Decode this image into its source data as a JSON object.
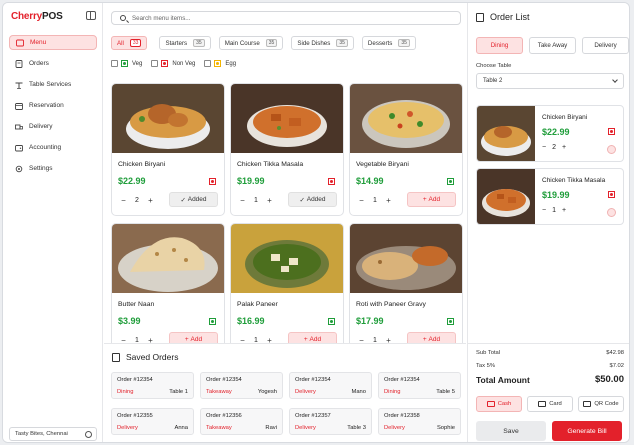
{
  "brand": {
    "part1": "Cherry",
    "part2": "POS"
  },
  "sidebar": {
    "items": [
      {
        "label": "Menu",
        "icon": "menu-icon",
        "active": true
      },
      {
        "label": "Orders",
        "icon": "orders-icon"
      },
      {
        "label": "Table Services",
        "icon": "table-icon"
      },
      {
        "label": "Reservation",
        "icon": "reservation-icon"
      },
      {
        "label": "Delivery",
        "icon": "truck-icon"
      },
      {
        "label": "Accounting",
        "icon": "wallet-icon"
      },
      {
        "label": "Settings",
        "icon": "gear-icon"
      }
    ],
    "store": "Tasty Bites, Chennai"
  },
  "search": {
    "placeholder": "Search menu items..."
  },
  "categories": [
    {
      "label": "All",
      "count": "33",
      "active": true
    },
    {
      "label": "Starters",
      "count": "35"
    },
    {
      "label": "Main Course",
      "count": "35"
    },
    {
      "label": "Side Dishes",
      "count": "35"
    },
    {
      "label": "Desserts",
      "count": "35"
    }
  ],
  "filters": [
    {
      "label": "Veg",
      "color": "#1f9d3a"
    },
    {
      "label": "Non Veg",
      "color": "#e3212b"
    },
    {
      "label": "Egg",
      "color": "#f2b400"
    }
  ],
  "menu_items": [
    {
      "name": "Chicken Biryani",
      "price": "$22.99",
      "qty": "2",
      "veg": false,
      "button": "Added",
      "added": true
    },
    {
      "name": "Chicken Tikka Masala",
      "price": "$19.99",
      "qty": "1",
      "veg": false,
      "button": "Added",
      "added": true
    },
    {
      "name": "Vegetable Biryani",
      "price": "$14.99",
      "qty": "1",
      "veg": true,
      "button": "Add",
      "added": false
    },
    {
      "name": "Butter Naan",
      "price": "$3.99",
      "qty": "1",
      "veg": true,
      "button": "Add",
      "added": false
    },
    {
      "name": "Palak Paneer",
      "price": "$16.99",
      "qty": "1",
      "veg": true,
      "button": "Add",
      "added": false
    },
    {
      "name": "Roti with Paneer Gravy",
      "price": "$17.99",
      "qty": "1",
      "veg": true,
      "button": "Add",
      "added": false
    }
  ],
  "saved": {
    "title": "Saved Orders",
    "orders": [
      {
        "id": "Order #12354",
        "type": "Dining",
        "who": "Table 1"
      },
      {
        "id": "Order #12354",
        "type": "Takeaway",
        "who": "Yogesh"
      },
      {
        "id": "Order #12354",
        "type": "Delivery",
        "who": "Mano"
      },
      {
        "id": "Order #12354",
        "type": "Dining",
        "who": "Table 5"
      },
      {
        "id": "Order #12355",
        "type": "Delivery",
        "who": "Anna"
      },
      {
        "id": "Order #12356",
        "type": "Takeaway",
        "who": "Ravi"
      },
      {
        "id": "Order #12357",
        "type": "Delivery",
        "who": "Table 3"
      },
      {
        "id": "Order #12358",
        "type": "Delivery",
        "who": "Sophie"
      }
    ]
  },
  "order": {
    "title": "Order List",
    "types": [
      "Dining",
      "Take Away",
      "Delivery"
    ],
    "choose_label": "Choose Table",
    "table": "Table 2",
    "items": [
      {
        "name": "Chicken Biryani",
        "price": "$22.99",
        "qty": "2"
      },
      {
        "name": "Chicken Tikka Masala",
        "price": "$19.99",
        "qty": "1"
      }
    ],
    "subtotal_label": "Sub Total",
    "subtotal": "$42.98",
    "tax_label": "Tax 5%",
    "tax": "$7.02",
    "total_label": "Total Amount",
    "total": "$50.00",
    "payments": [
      "Cash",
      "Card",
      "QR Code"
    ],
    "save_label": "Save",
    "generate_label": "Generate Bill"
  }
}
